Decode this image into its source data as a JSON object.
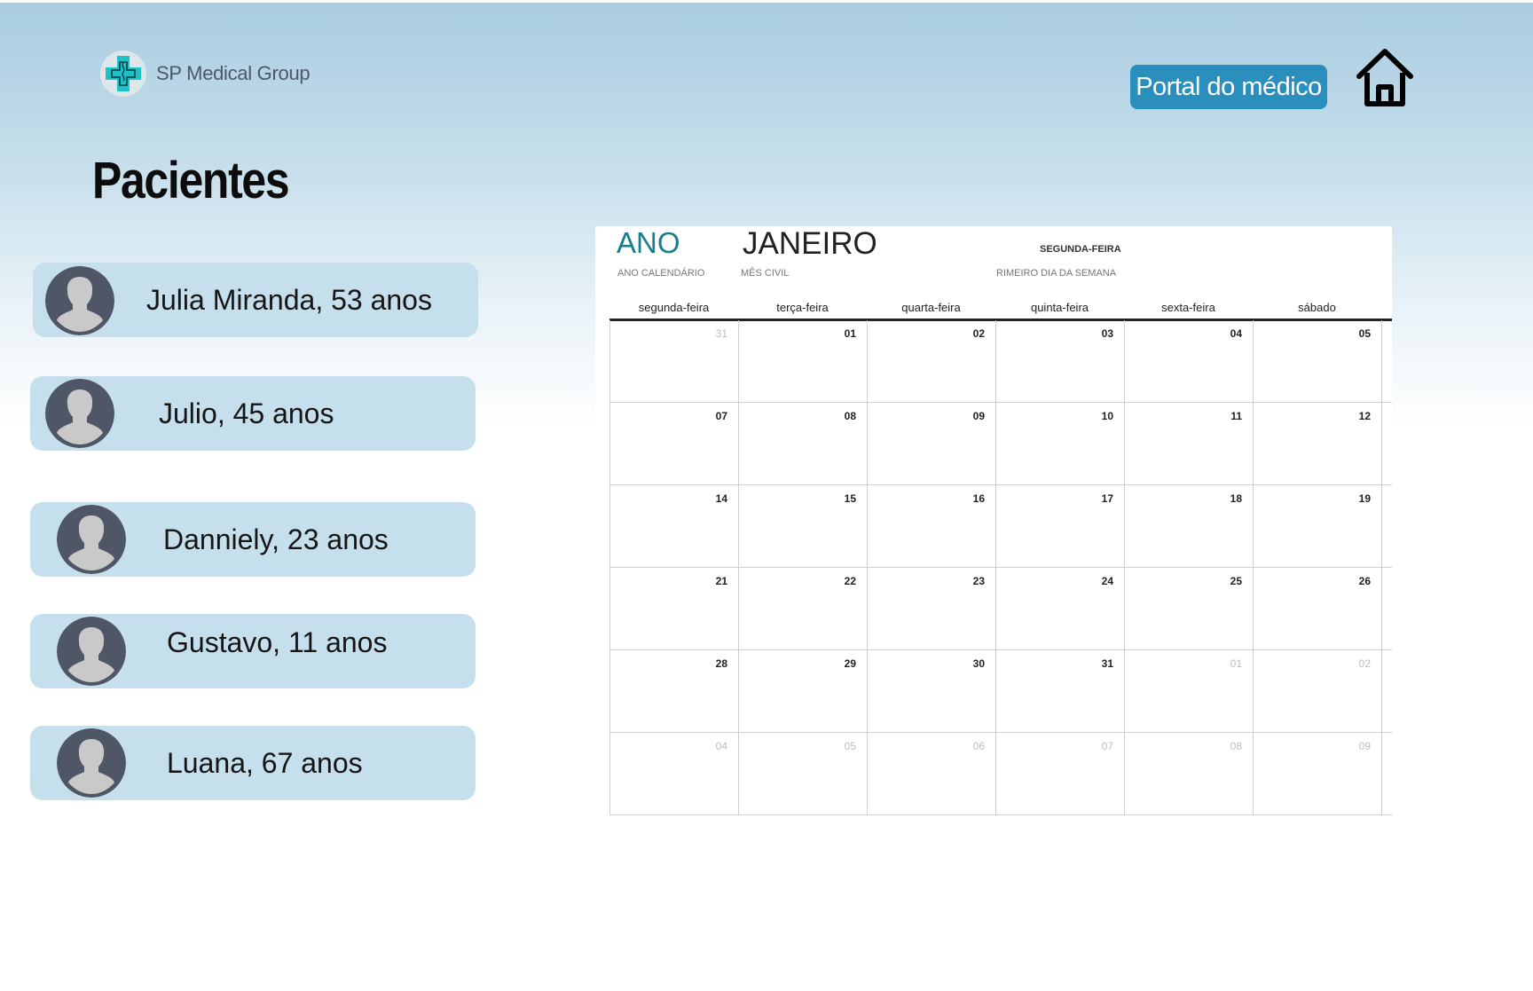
{
  "header": {
    "logo_text": "SP Medical Group",
    "portal_button": "Portal do médico",
    "home_icon": "home-icon"
  },
  "page": {
    "title": "Pacientes"
  },
  "patients": [
    {
      "name": "Julia Miranda, 53 anos"
    },
    {
      "name": "Julio, 45 anos"
    },
    {
      "name": "Danniely, 23 anos"
    },
    {
      "name": "Gustavo, 11 anos"
    },
    {
      "name": "Luana, 67 anos"
    }
  ],
  "calendar": {
    "year_label": "ANO",
    "year_sub": "ANO CALENDÁRIO",
    "month_label": "JANEIRO",
    "month_sub": "MÊS CIVIL",
    "first_day_label": "SEGUNDA-FEIRA",
    "first_day_sub": "RIMEIRO DIA DA SEMANA",
    "weekdays": [
      "segunda-feira",
      "terça-feira",
      "quarta-feira",
      "quinta-feira",
      "sexta-feira",
      "sábado"
    ],
    "weeks": [
      [
        {
          "d": "31",
          "m": true
        },
        {
          "d": "01"
        },
        {
          "d": "02"
        },
        {
          "d": "03"
        },
        {
          "d": "04"
        },
        {
          "d": "05"
        }
      ],
      [
        {
          "d": "07"
        },
        {
          "d": "08"
        },
        {
          "d": "09"
        },
        {
          "d": "10"
        },
        {
          "d": "11"
        },
        {
          "d": "12"
        }
      ],
      [
        {
          "d": "14"
        },
        {
          "d": "15"
        },
        {
          "d": "16"
        },
        {
          "d": "17"
        },
        {
          "d": "18"
        },
        {
          "d": "19"
        }
      ],
      [
        {
          "d": "21"
        },
        {
          "d": "22"
        },
        {
          "d": "23"
        },
        {
          "d": "24"
        },
        {
          "d": "25"
        },
        {
          "d": "26"
        }
      ],
      [
        {
          "d": "28"
        },
        {
          "d": "29"
        },
        {
          "d": "30"
        },
        {
          "d": "31"
        },
        {
          "d": "01",
          "m": true
        },
        {
          "d": "02",
          "m": true
        }
      ],
      [
        {
          "d": "04",
          "m": true
        },
        {
          "d": "05",
          "m": true
        },
        {
          "d": "06",
          "m": true
        },
        {
          "d": "07",
          "m": true
        },
        {
          "d": "08",
          "m": true
        },
        {
          "d": "09",
          "m": true
        }
      ]
    ]
  },
  "colors": {
    "accent": "#2a8fbd",
    "card": "#c6dfec",
    "year_teal": "#1a7d8c"
  }
}
